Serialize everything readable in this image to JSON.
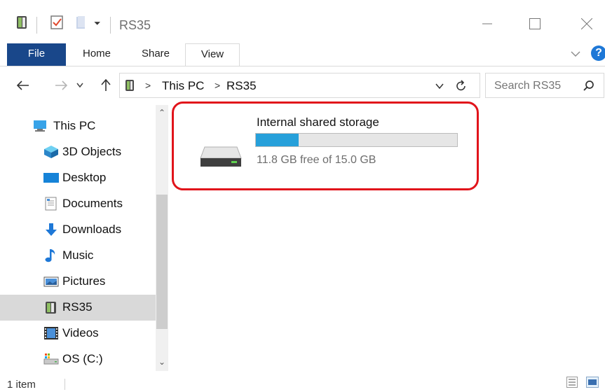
{
  "window": {
    "title": "RS35"
  },
  "ribbon": {
    "tabs": [
      "File",
      "Home",
      "Share",
      "View"
    ],
    "active_tab": "View"
  },
  "address": {
    "segments": [
      "This PC",
      "RS35"
    ]
  },
  "search": {
    "placeholder": "Search RS35"
  },
  "sidebar": {
    "items": [
      {
        "label": "This PC",
        "icon": "computer-icon"
      },
      {
        "label": "3D Objects",
        "icon": "3d-objects-icon"
      },
      {
        "label": "Desktop",
        "icon": "desktop-icon"
      },
      {
        "label": "Documents",
        "icon": "documents-icon"
      },
      {
        "label": "Downloads",
        "icon": "downloads-icon"
      },
      {
        "label": "Music",
        "icon": "music-icon"
      },
      {
        "label": "Pictures",
        "icon": "pictures-icon"
      },
      {
        "label": "RS35",
        "icon": "device-icon",
        "selected": true
      },
      {
        "label": "Videos",
        "icon": "videos-icon"
      },
      {
        "label": "OS (C:)",
        "icon": "drive-icon"
      }
    ]
  },
  "storage": {
    "name": "Internal shared storage",
    "free_text": "11.8 GB free of 15.0 GB",
    "used_fraction": 0.213
  },
  "status": {
    "item_count": "1 item"
  },
  "colors": {
    "file_tab": "#19478a",
    "selection": "#d9d9d9",
    "progress": "#26a0da",
    "highlight": "#e1141b"
  }
}
